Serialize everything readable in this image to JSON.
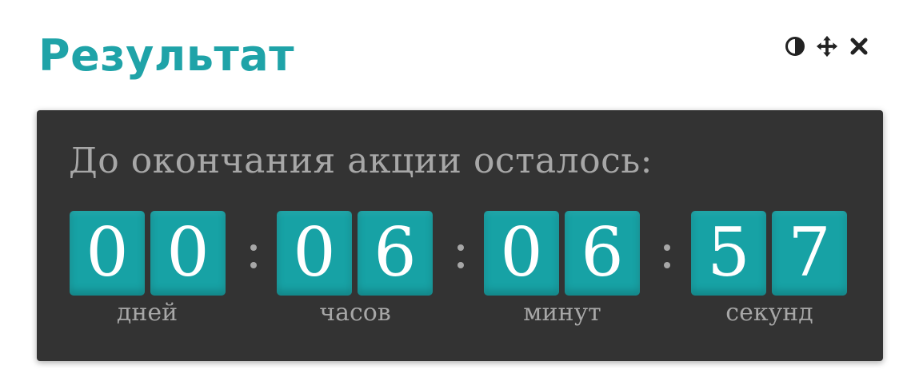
{
  "header": {
    "title": "Результат"
  },
  "toolbar": {
    "icons": [
      "contrast-icon",
      "move-icon",
      "close-icon"
    ]
  },
  "countdown": {
    "caption": "До окончания акции осталось:",
    "separator": ":",
    "groups": [
      {
        "digits": [
          "0",
          "0"
        ],
        "unit": "дней"
      },
      {
        "digits": [
          "0",
          "6"
        ],
        "unit": "часов"
      },
      {
        "digits": [
          "0",
          "6"
        ],
        "unit": "минут"
      },
      {
        "digits": [
          "5",
          "7"
        ],
        "unit": "секунд"
      }
    ]
  },
  "colors": {
    "accent": "#1fa3a8",
    "panel": "#333333",
    "digit_tile": "#17a2a5",
    "muted_text": "#a7a7a7"
  }
}
